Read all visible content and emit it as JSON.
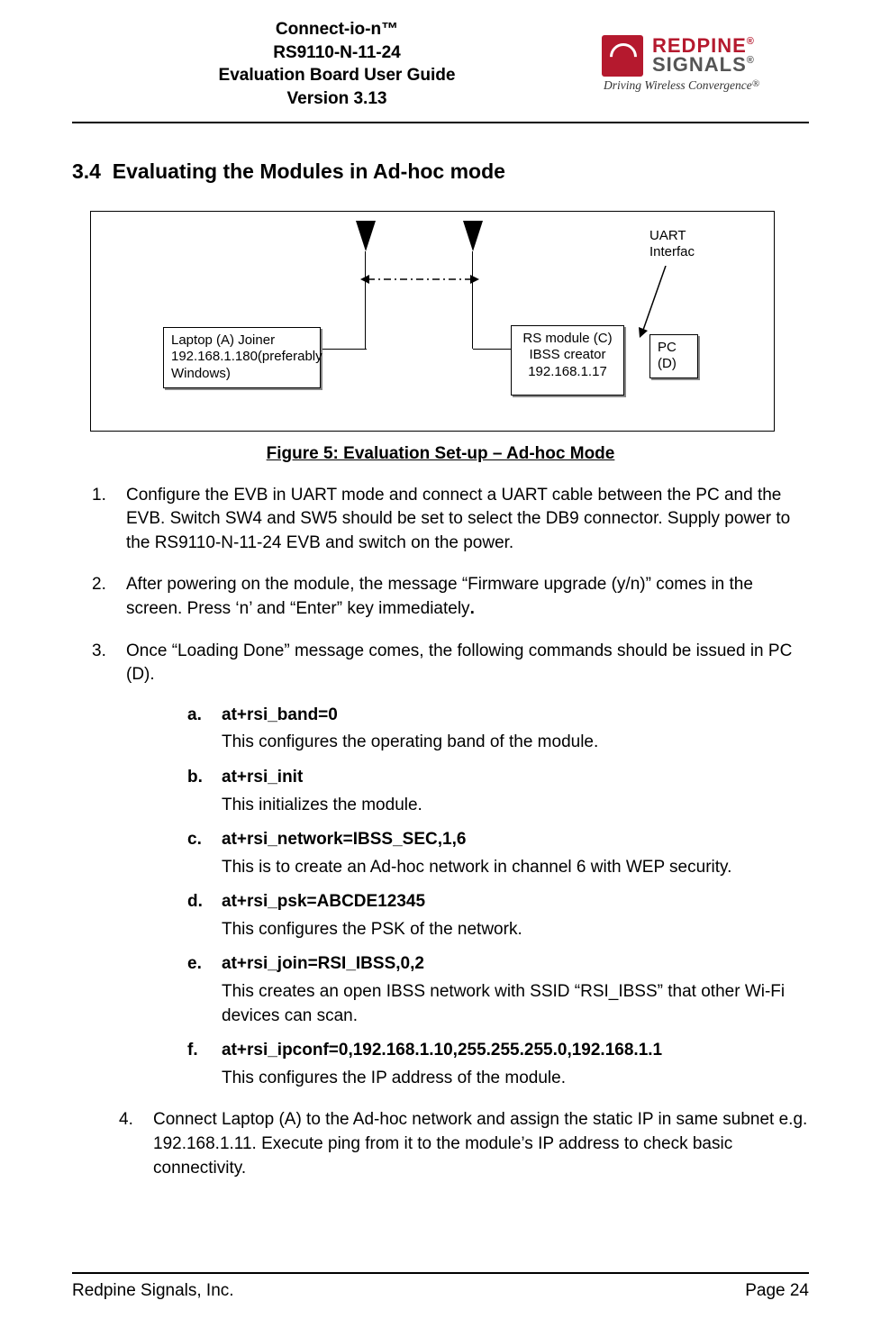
{
  "header": {
    "line1": "Connect-io-n™",
    "line2": "RS9110-N-11-24",
    "line3": "Evaluation Board User Guide",
    "line4": "Version 3.13"
  },
  "logo": {
    "line1": "REDPINE",
    "line2": "SIGNALS",
    "reg": "®",
    "tagline": "Driving Wireless Convergence"
  },
  "section": {
    "number": "3.4",
    "title": "Evaluating the Modules in Ad-hoc mode"
  },
  "figure": {
    "laptop_label": "Laptop (A) Joiner 192.168.1.180(preferably Windows)",
    "rs_label": "RS module (C) IBSS creator 192.168.1.17",
    "pc_label_l1": "PC",
    "pc_label_l2": "(D)",
    "uart_label_l1": "UART",
    "uart_label_l2": "Interfac",
    "caption": "Figure 5: Evaluation Set-up – Ad-hoc Mode"
  },
  "steps": [
    "Configure the EVB in UART mode and connect a UART cable between the PC and the EVB. Switch SW4 and SW5 should be set to select the DB9 connector. Supply power to the RS9110-N-11-24 EVB and switch on the power.",
    "After powering on the module, the message “Firmware upgrade (y/n)” comes in the screen. Press ‘n’ and “Enter” key immediately",
    "Once “Loading Done” message comes, the following commands should be issued in PC (D).",
    "Connect Laptop (A) to the Ad-hoc network and assign the static IP in same subnet e.g. 192.168.1.11. Execute ping from it to the module’s IP address to check basic connectivity."
  ],
  "substeps": [
    {
      "cmd": "at+rsi_band=0",
      "desc": "This configures the operating band of the module."
    },
    {
      "cmd": "at+rsi_init",
      "desc": "This initializes the module."
    },
    {
      "cmd": "at+rsi_network=IBSS_SEC,1,6",
      "desc": "This is to create an Ad-hoc network in channel 6 with WEP security."
    },
    {
      "cmd": "at+rsi_psk=ABCDE12345",
      "desc": "This configures the PSK of the network."
    },
    {
      "cmd": "at+rsi_join=RSI_IBSS,0,2",
      "desc": "This creates an open IBSS network with SSID “RSI_IBSS” that other Wi-Fi devices can scan."
    },
    {
      "cmd": "at+rsi_ipconf=0,192.168.1.10,255.255.255.0,192.168.1.1",
      "desc": "This configures the IP address of the module."
    }
  ],
  "footer": {
    "left": "Redpine Signals, Inc.",
    "right": "Page 24"
  }
}
